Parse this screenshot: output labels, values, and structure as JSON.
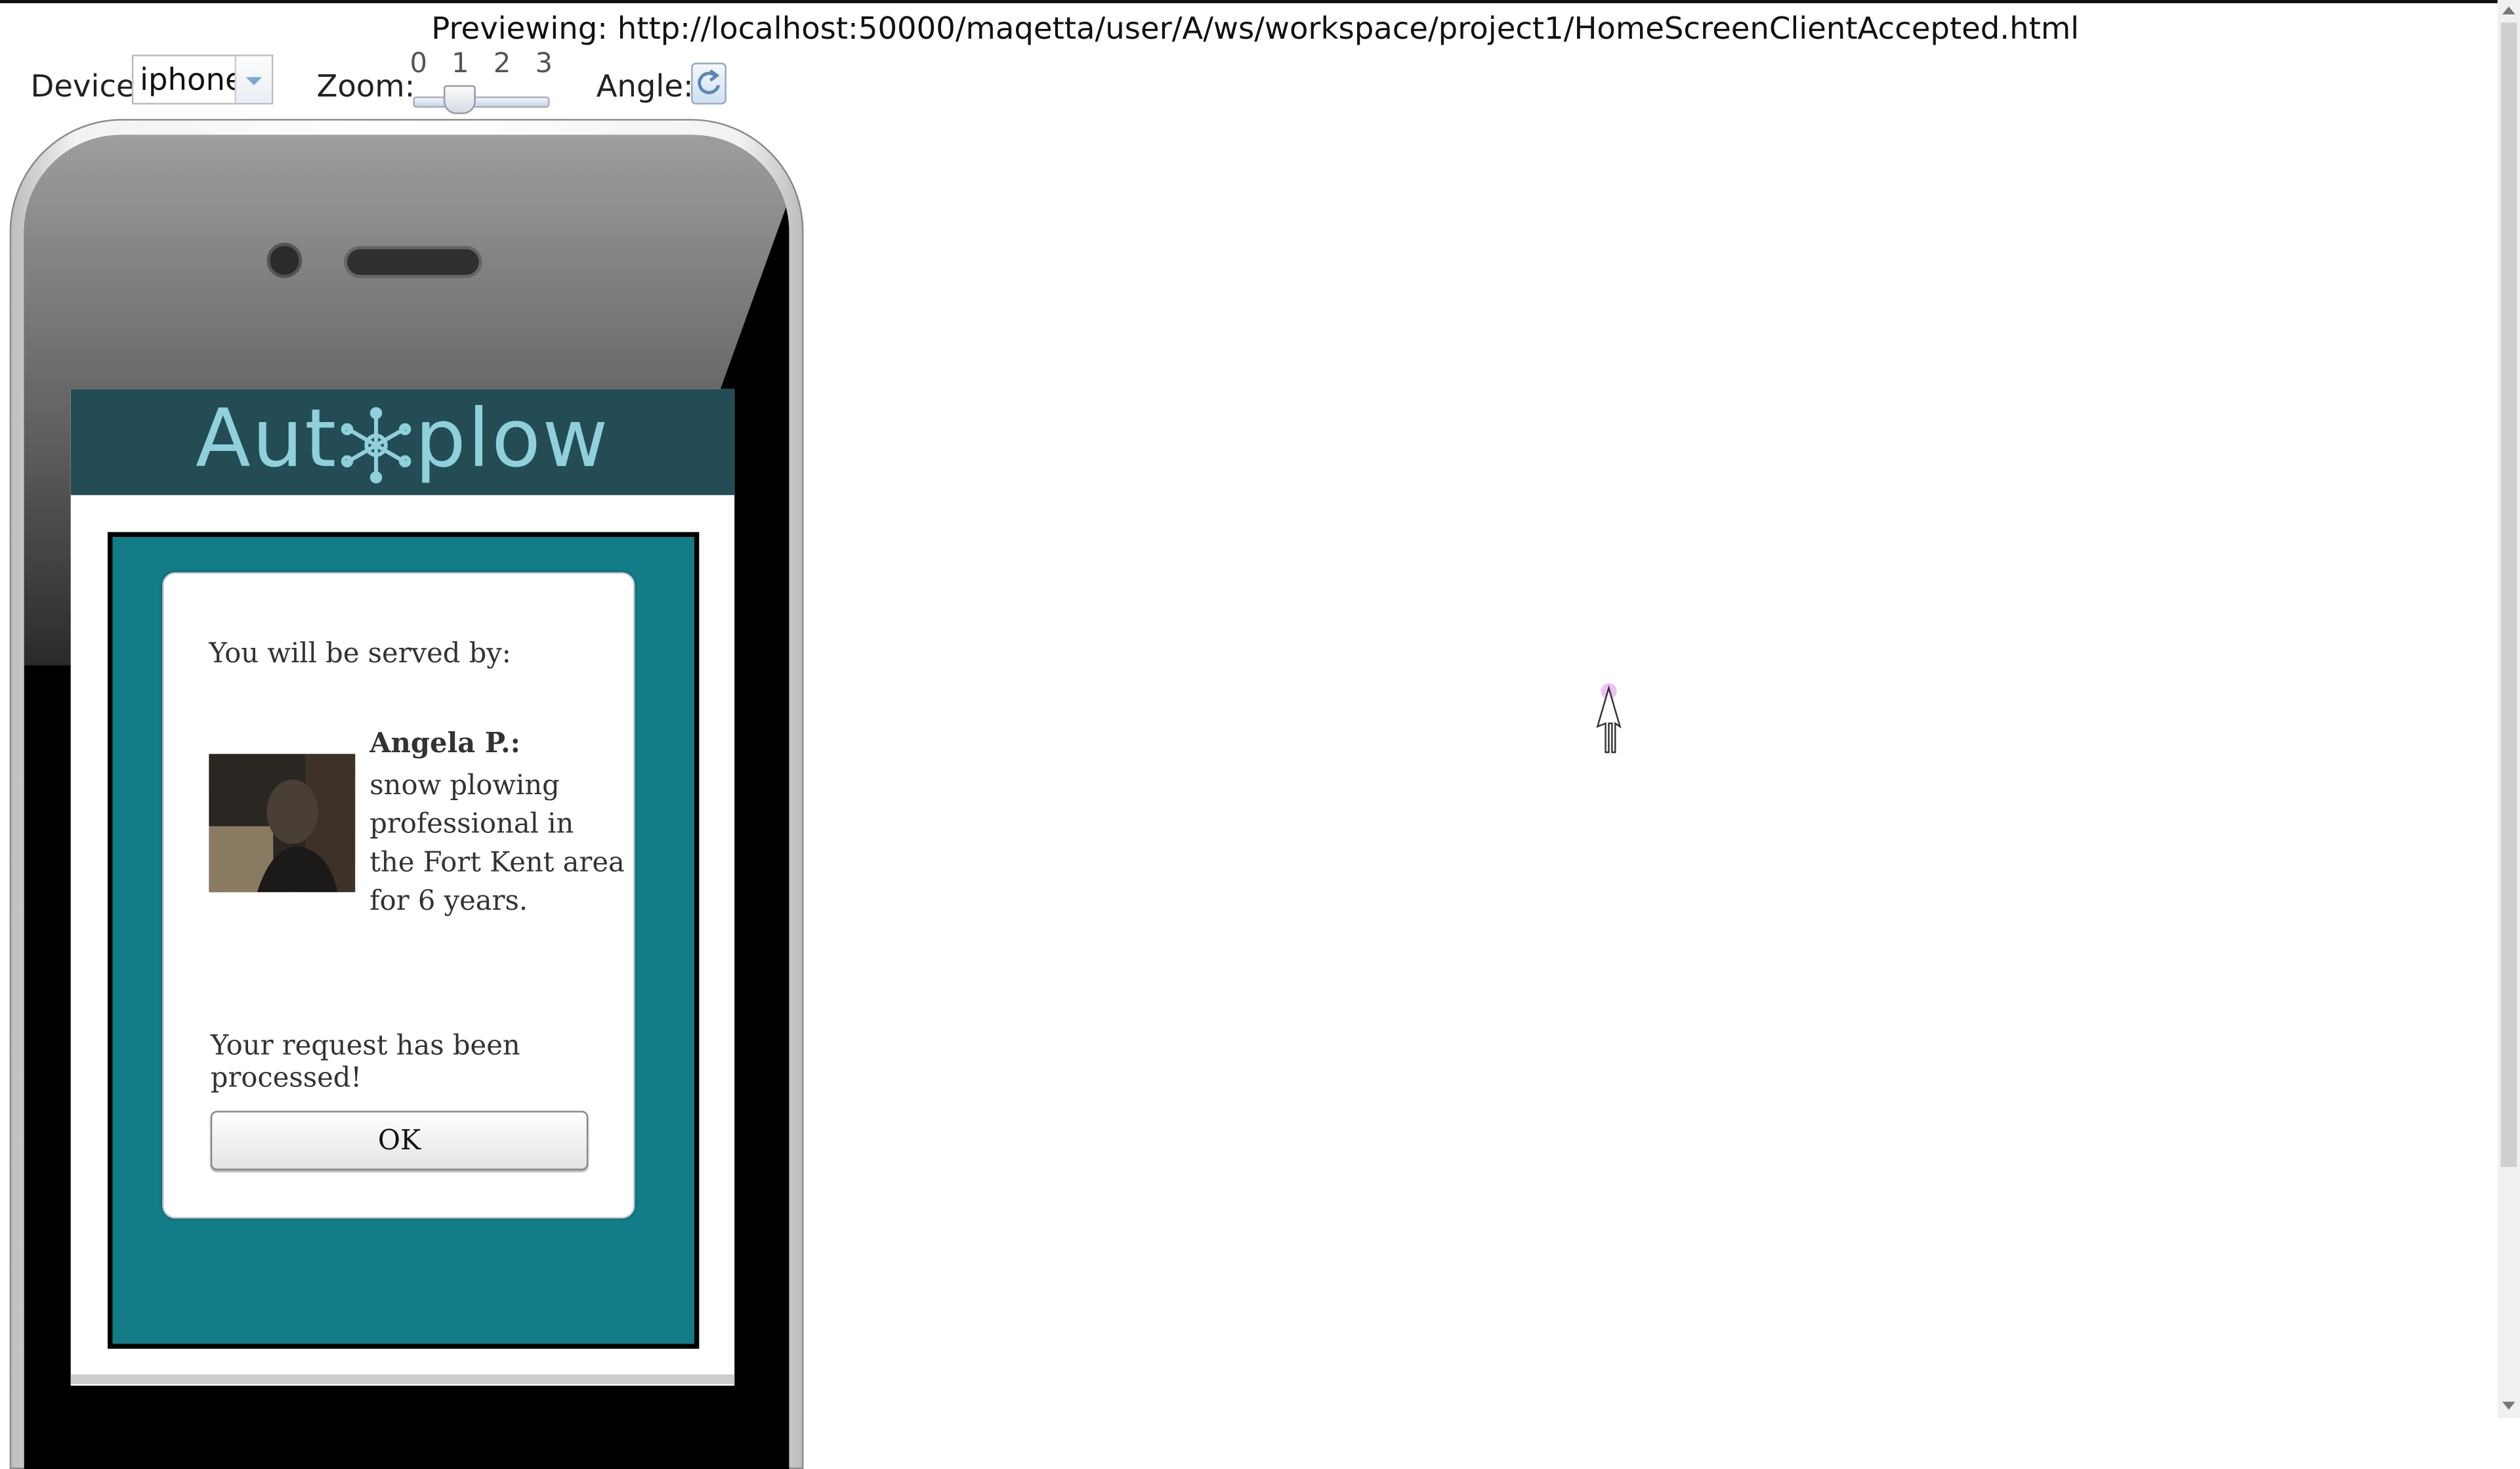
{
  "preview": {
    "title": "Previewing: http://localhost:50000/maqetta/user/A/ws/workspace/project1/HomeScreenClientAccepted.html"
  },
  "toolbar": {
    "device_label": "Device:",
    "device_value": "iphone",
    "zoom_label": "Zoom:",
    "zoom_ticks": [
      "0",
      "1",
      "2",
      "3"
    ],
    "zoom_level": 1,
    "angle_label": "Angle:"
  },
  "app": {
    "logo_left": "Aut",
    "logo_right": "plow",
    "served_label": "You will be served by:",
    "provider_name": "Angela P.:",
    "provider_bio": "snow plowing professional in the Fort Kent area for 6 years.",
    "processed_message": "Your request has been processed!",
    "ok_label": "OK"
  },
  "colors": {
    "header_bg": "#234c55",
    "logo_text": "#8fd0da",
    "panel_bg": "#127d87"
  },
  "icons": {
    "device_dropdown": "chevron-down-icon",
    "angle": "rotate-icon",
    "logo_mark": "snowflake-icon",
    "cursor": "pointer-cursor-icon"
  }
}
